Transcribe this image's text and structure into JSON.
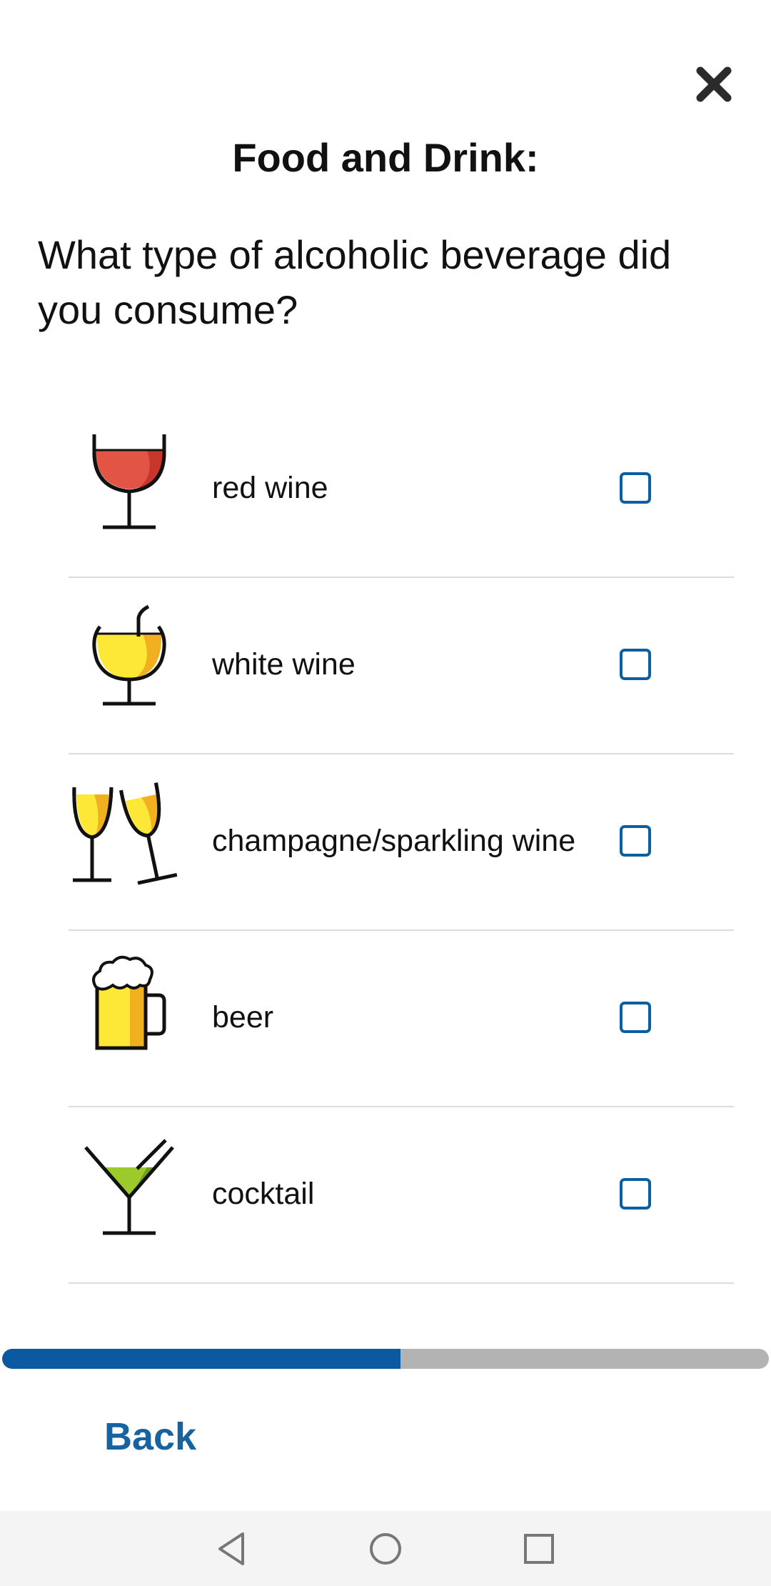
{
  "header": {
    "title": "Food and Drink:",
    "close_icon": "close-icon"
  },
  "question": "What type of alcoholic beverage did you consume?",
  "options": [
    {
      "label": "red wine",
      "icon": "red-wine-glass-icon",
      "checked": false
    },
    {
      "label": "white wine",
      "icon": "white-wine-glass-icon",
      "checked": false
    },
    {
      "label": "champagne/sparkling wine",
      "icon": "champagne-glasses-icon",
      "checked": false
    },
    {
      "label": "beer",
      "icon": "beer-mug-icon",
      "checked": false
    },
    {
      "label": "cocktail",
      "icon": "cocktail-glass-icon",
      "checked": false
    }
  ],
  "progress": {
    "fraction": 0.52
  },
  "footer": {
    "back_label": "Back"
  },
  "colors": {
    "accent": "#0b5aa1",
    "progress_track": "#b3b3b3",
    "checkbox_border": "#0b5fa0",
    "back_text": "#17639f"
  }
}
